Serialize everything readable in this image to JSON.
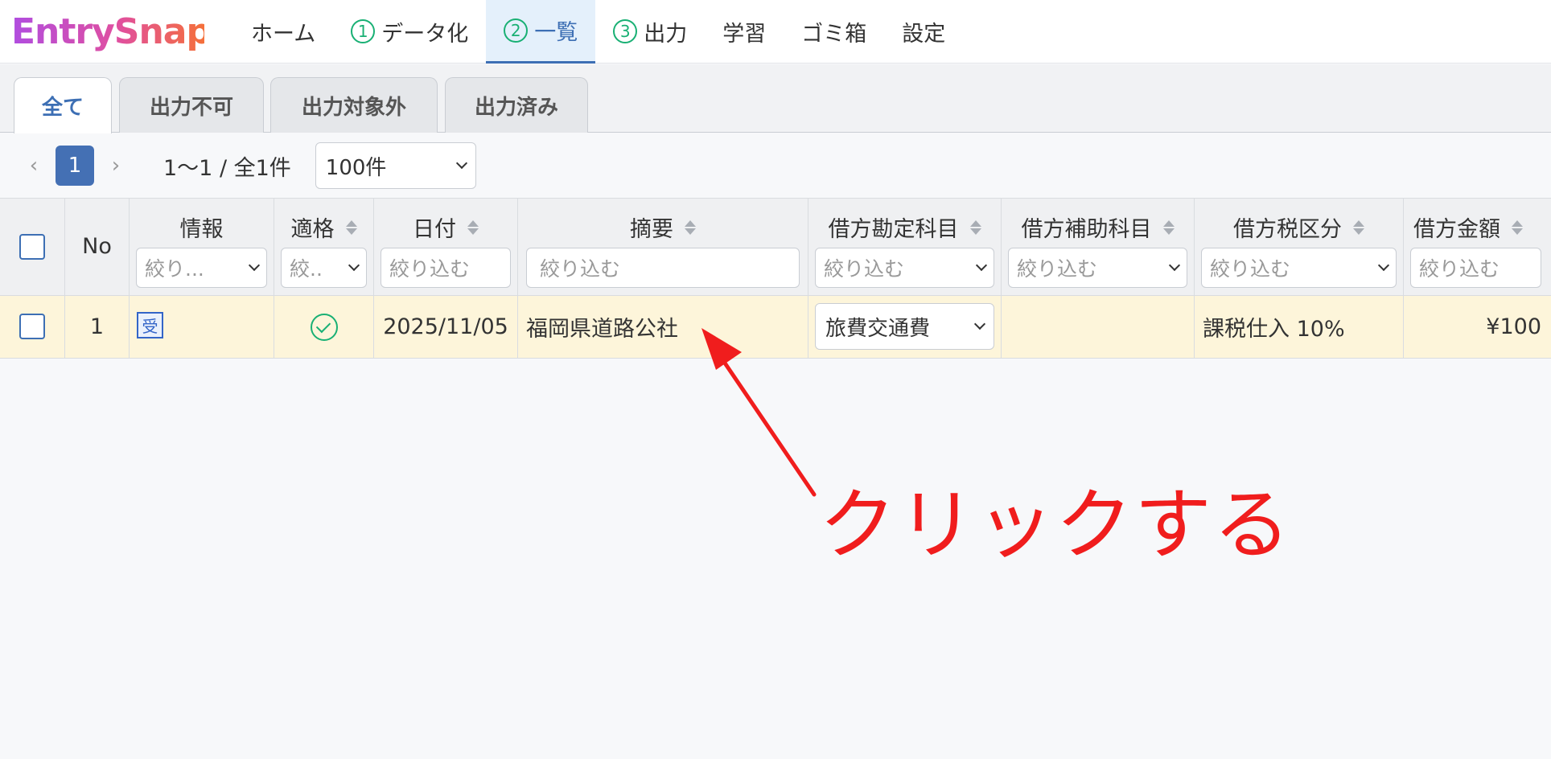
{
  "app": {
    "logo_text": "EntrySnap"
  },
  "nav": [
    {
      "label": "ホーム",
      "step": ""
    },
    {
      "label": "データ化",
      "step": "1"
    },
    {
      "label": "一覧",
      "step": "2"
    },
    {
      "label": "出力",
      "step": "3"
    },
    {
      "label": "学習",
      "step": ""
    },
    {
      "label": "ゴミ箱",
      "step": ""
    },
    {
      "label": "設定",
      "step": ""
    }
  ],
  "subtabs": [
    "全て",
    "出力不可",
    "出力対象外",
    "出力済み"
  ],
  "pager": {
    "current_page": "1",
    "range": "1〜1 / 全1件",
    "per_page": "100件"
  },
  "table": {
    "columns": [
      {
        "title": "No"
      },
      {
        "title": "情報",
        "filter": "絞り..."
      },
      {
        "title": "適格",
        "filter": "絞.."
      },
      {
        "title": "日付",
        "filter": "絞り込む"
      },
      {
        "title": "摘要",
        "filter": "絞り込む"
      },
      {
        "title": "借方勘定科目",
        "filter": "絞り込む"
      },
      {
        "title": "借方補助科目",
        "filter": "絞り込む"
      },
      {
        "title": "借方税区分",
        "filter": "絞り込む"
      },
      {
        "title": "借方金額",
        "filter": "絞り込む"
      }
    ],
    "rows": [
      {
        "no": "1",
        "info_badge": "受",
        "eligible": "check",
        "date": "2025/11/05",
        "summary": "福岡県道路公社",
        "debit_account": "旅費交通費",
        "debit_sub_account": "",
        "debit_tax": "課税仕入 10%",
        "debit_amount": "¥100"
      }
    ]
  },
  "annotation": {
    "text": "クリックする",
    "color": "#f01d1d"
  },
  "colors": {
    "accent": "#3d6fb4",
    "step_green": "#19b074",
    "row_highlight": "#fdf5da"
  }
}
